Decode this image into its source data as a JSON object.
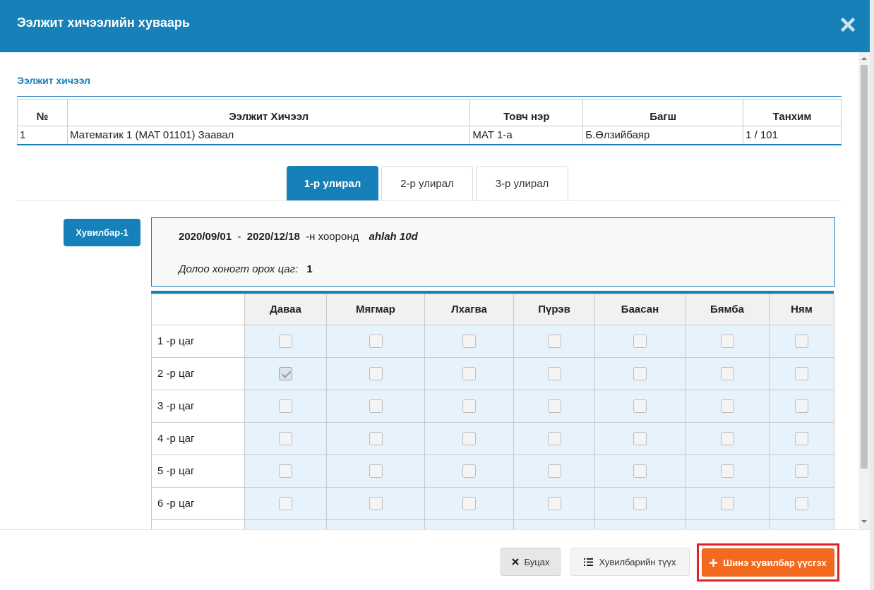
{
  "modal": {
    "title": "Ээлжит хичээлийн хуваарь"
  },
  "section": {
    "title": "Ээлжит хичээл"
  },
  "lesson_table": {
    "headers": [
      "№",
      "Ээлжит Хичээл",
      "Товч нэр",
      "Багш",
      "Танхим"
    ],
    "rows": [
      [
        "1",
        "Математик 1 (MAT 01101) Заавал",
        "МАТ 1-а",
        "Б.Өлзийбаяр",
        "1 / 101"
      ]
    ]
  },
  "tabs": [
    {
      "label": "1-р улирал",
      "active": true
    },
    {
      "label": "2-р улирал",
      "active": false
    },
    {
      "label": "3-р улирал",
      "active": false
    }
  ],
  "variant": {
    "button_label": "Хувилбар-1",
    "start_date": "2020/09/01",
    "separator": "-",
    "end_date": "2020/12/18",
    "between_label": "-н хооронд",
    "name": "ahlah 10d",
    "weekly_hours_label": "Долоо хоногт орох цаг:",
    "weekly_hours_value": "1"
  },
  "schedule": {
    "days": [
      "Даваа",
      "Мягмар",
      "Лхагва",
      "Пүрэв",
      "Баасан",
      "Бямба",
      "Ням"
    ],
    "periods": [
      "1 -р цаг",
      "2 -р цаг",
      "3 -р цаг",
      "4 -р цаг",
      "5 -р цаг",
      "6 -р цаг",
      ""
    ],
    "checked": [
      [
        1,
        0
      ]
    ]
  },
  "footer": {
    "back_label": "Буцах",
    "history_label": "Хувилбарийн түүх",
    "new_label": "Шинэ хувилбар үүсгэх"
  },
  "colors": {
    "primary": "#1680b8",
    "accent": "#f36a1f",
    "highlight_outline": "#e0202a",
    "cell_bg": "#e6f2fc"
  },
  "icons": {
    "close": "close-icon",
    "back": "x-icon",
    "history": "list-icon",
    "new": "plus-icon"
  }
}
